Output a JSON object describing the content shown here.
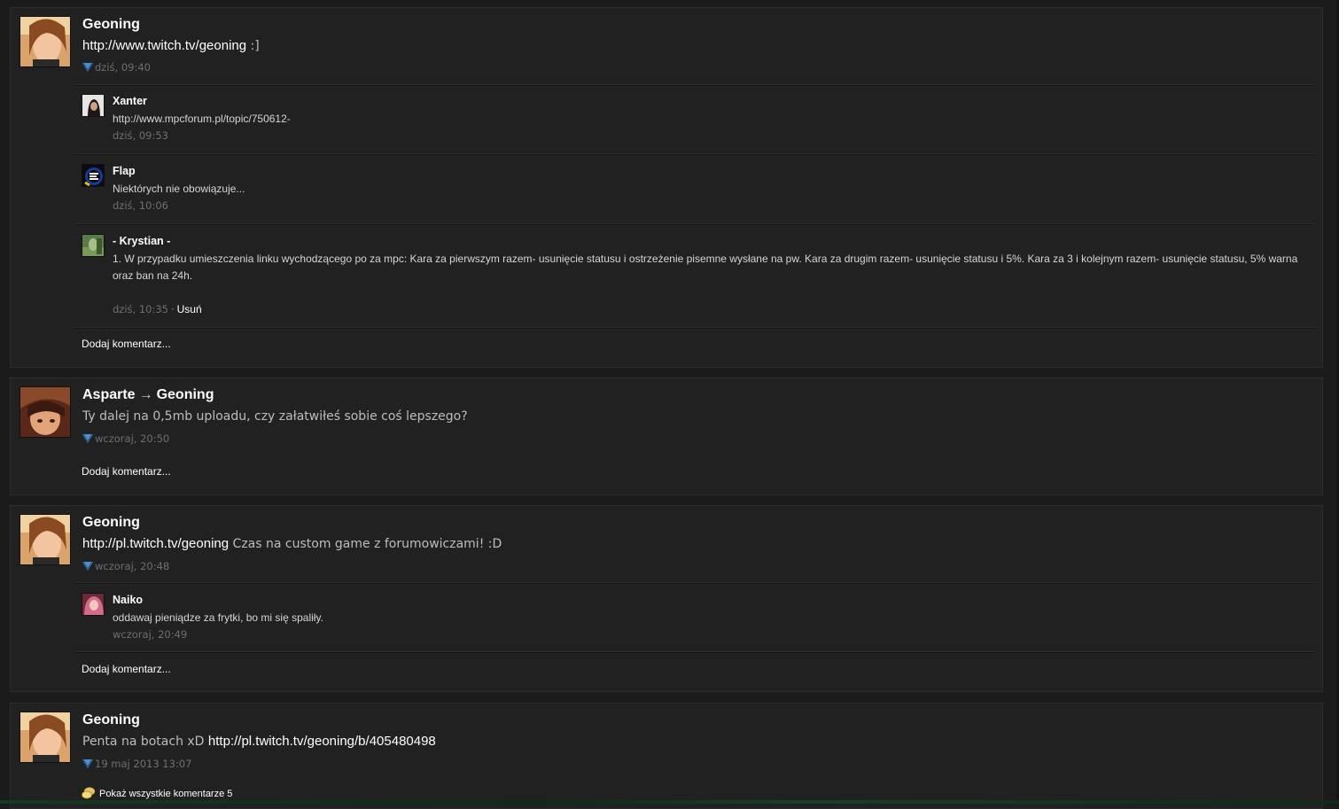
{
  "posts": [
    {
      "author": "Geoning",
      "link": "http://www.twitch.tv/geoning",
      "text": " :]",
      "time": "dziś, 09:40",
      "comments": [
        {
          "author": "Xanter",
          "text": "http://www.mpcforum.pl/topic/750612-",
          "time": "dziś, 09:53"
        },
        {
          "author": "Flap",
          "text": "Niektórych nie obowiązuje...",
          "time": "dziś, 10:06"
        },
        {
          "author": "- Krystian -",
          "text": "1. W przypadku umieszczenia linku wychodzącego po za mpc: Kara za pierwszym razem- usunięcie statusu i ostrzeżenie pisemne wysłane na pw. Kara za drugim razem- usunięcie statusu i 5%. Kara za 3 i kolejnym razem- usunięcie statusu, 5% warna oraz ban na 24h.",
          "time": "dziś, 10:35",
          "action": "Usuń"
        }
      ],
      "add_comment": "Dodaj komentarz..."
    },
    {
      "author": "Asparte",
      "arrow": "→",
      "target": "Geoning",
      "text": "Ty dalej na 0,5mb uploadu, czy załatwiłeś sobie coś lepszego?",
      "time": "wczoraj, 20:50",
      "add_comment": "Dodaj komentarz..."
    },
    {
      "author": "Geoning",
      "link": "http://pl.twitch.tv/geoning",
      "text": " Czas na custom game z forumowiczami! :D",
      "time": "wczoraj, 20:48",
      "comments": [
        {
          "author": "Naiko",
          "text": "oddawaj pieniądze za frytki, bo mi się spaliły.",
          "time": "wczoraj, 20:49"
        }
      ],
      "add_comment": "Dodaj komentarz..."
    },
    {
      "author": "Geoning",
      "text_before": "Penta na botach xD ",
      "link": "http://pl.twitch.tv/geoning/b/405480498",
      "time": "19 maj 2013 13:07",
      "show_all": "Pokaż wszystkie komentarze 5"
    }
  ],
  "icons": {
    "mobile": "mobile-status-icon",
    "comments": "comments-bubble-icon"
  }
}
